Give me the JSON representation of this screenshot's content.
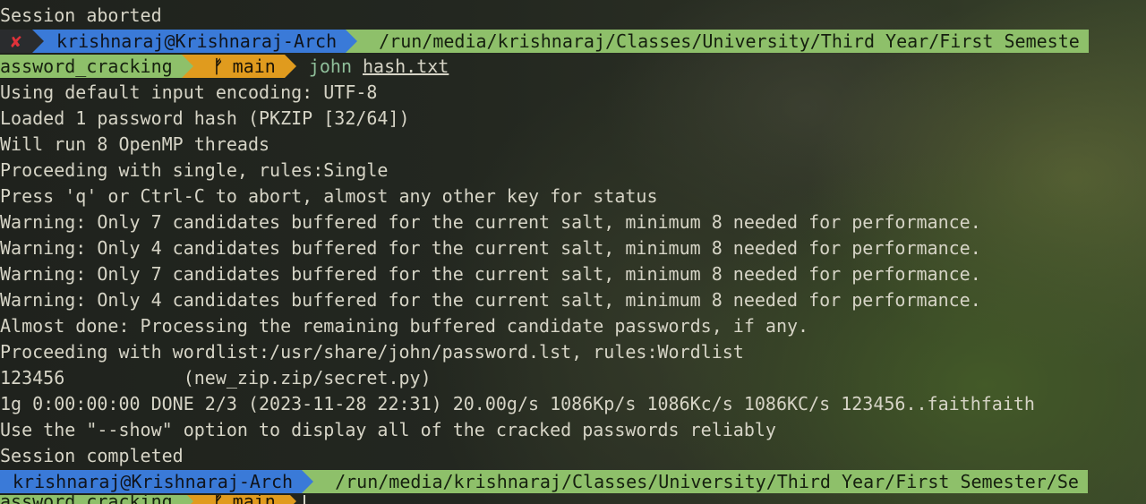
{
  "terminal": {
    "line_session_aborted": "Session aborted",
    "prompt1": {
      "status_icon": "✘",
      "user_host": "krishnaraj@Krishnaraj-Arch",
      "path": "/run/media/krishnaraj/Classes/University/Third Year/First Semeste"
    },
    "prompt1b": {
      "dir": "assword_cracking",
      "branch_icon": "ᚠ",
      "branch": "main",
      "command": "john",
      "argument": "hash.txt"
    },
    "output": [
      "Using default input encoding: UTF-8",
      "Loaded 1 password hash (PKZIP [32/64])",
      "Will run 8 OpenMP threads",
      "Proceeding with single, rules:Single",
      "Press 'q' or Ctrl-C to abort, almost any other key for status",
      "Warning: Only 7 candidates buffered for the current salt, minimum 8 needed for performance.",
      "Warning: Only 4 candidates buffered for the current salt, minimum 8 needed for performance.",
      "Warning: Only 7 candidates buffered for the current salt, minimum 8 needed for performance.",
      "Warning: Only 4 candidates buffered for the current salt, minimum 8 needed for performance.",
      "Almost done: Processing the remaining buffered candidate passwords, if any.",
      "Proceeding with wordlist:/usr/share/john/password.lst, rules:Wordlist",
      "123456           (new_zip.zip/secret.py)",
      "1g 0:00:00:00 DONE 2/3 (2023-11-28 22:31) 20.00g/s 1086Kp/s 1086Kc/s 1086KC/s 123456..faithfaith",
      "Use the \"--show\" option to display all of the cracked passwords reliably",
      "Session completed"
    ],
    "prompt2": {
      "user_host": "krishnaraj@Krishnaraj-Arch",
      "path": "/run/media/krishnaraj/Classes/University/Third Year/First Semester/Se"
    },
    "prompt2b": {
      "dir": "assword_cracking",
      "branch_icon": "ᚠ",
      "branch": "main"
    }
  }
}
